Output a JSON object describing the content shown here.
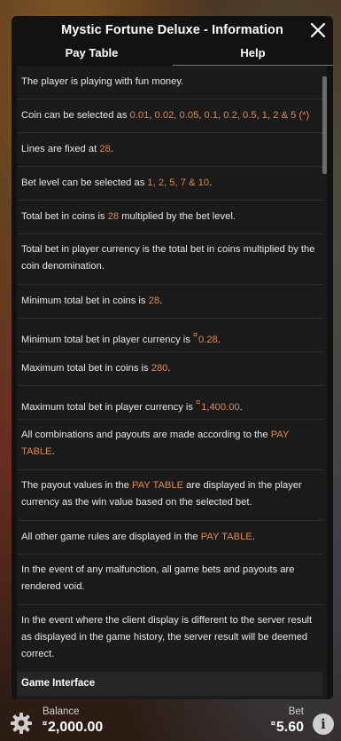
{
  "header": {
    "title": "Mystic Fortune Deluxe - Information",
    "close_icon": "close-icon"
  },
  "tabs": {
    "pay_table": "Pay Table",
    "help": "Help",
    "active": "Help"
  },
  "rules": {
    "r1": {
      "a": "The player is playing with fun money."
    },
    "r2": {
      "a": "Coin can be selected as ",
      "h": "0.01, 0.02, 0.05, 0.1, 0.2, 0.5, 1, 2 & 5 (*)"
    },
    "r3": {
      "a": "Lines are fixed at ",
      "h": "28",
      "b": "."
    },
    "r4": {
      "a": "Bet level can be selected as ",
      "h": "1, 2, 5, 7 & 10",
      "b": "."
    },
    "r5": {
      "a": "Total bet in coins is ",
      "h": "28",
      "b": " multiplied by the bet level."
    },
    "r6": {
      "a": "Total bet in player currency is the total bet in coins multiplied by the coin denomination."
    },
    "r7": {
      "a": "Minimum total bet in coins is ",
      "h": "28",
      "b": "."
    },
    "r8": {
      "a": "Minimum total bet in player currency is ",
      "hsup": "¤",
      "h": "0.28",
      "b": "."
    },
    "r9": {
      "a": "Maximum total bet in coins is ",
      "h": "280",
      "b": "."
    },
    "r10": {
      "a": "Maximum total bet in player currency is ",
      "hsup": "¤",
      "h": "1,400.00",
      "b": "."
    },
    "r11": {
      "a": "All combinations and payouts are made according to the ",
      "h": "PAY TABLE",
      "b": "."
    },
    "r12": {
      "a": "The payout values in the ",
      "h": "PAY TABLE",
      "b": " are displayed in the player currency as the win value based on the selected bet."
    },
    "r13": {
      "a": "All other game rules are displayed in the ",
      "h": "PAY TABLE",
      "b": "."
    },
    "r14": {
      "a": "In the event of any malfunction, all game bets and payouts are rendered void."
    },
    "r15": {
      "a": "In the event where the client display is different to the server result as displayed in the game history, the server result will be deemed correct."
    }
  },
  "section": {
    "game_interface": "Game Interface"
  },
  "footer": {
    "balance_label": "Balance",
    "balance_currency": "¤",
    "balance_value": "2,000.00",
    "bet_label": "Bet",
    "bet_currency": "¤",
    "bet_value": "5.60",
    "info_glyph": "i"
  },
  "colors": {
    "highlight": "#e08a4a",
    "panel": "#121212",
    "content": "#1b1b1b"
  }
}
